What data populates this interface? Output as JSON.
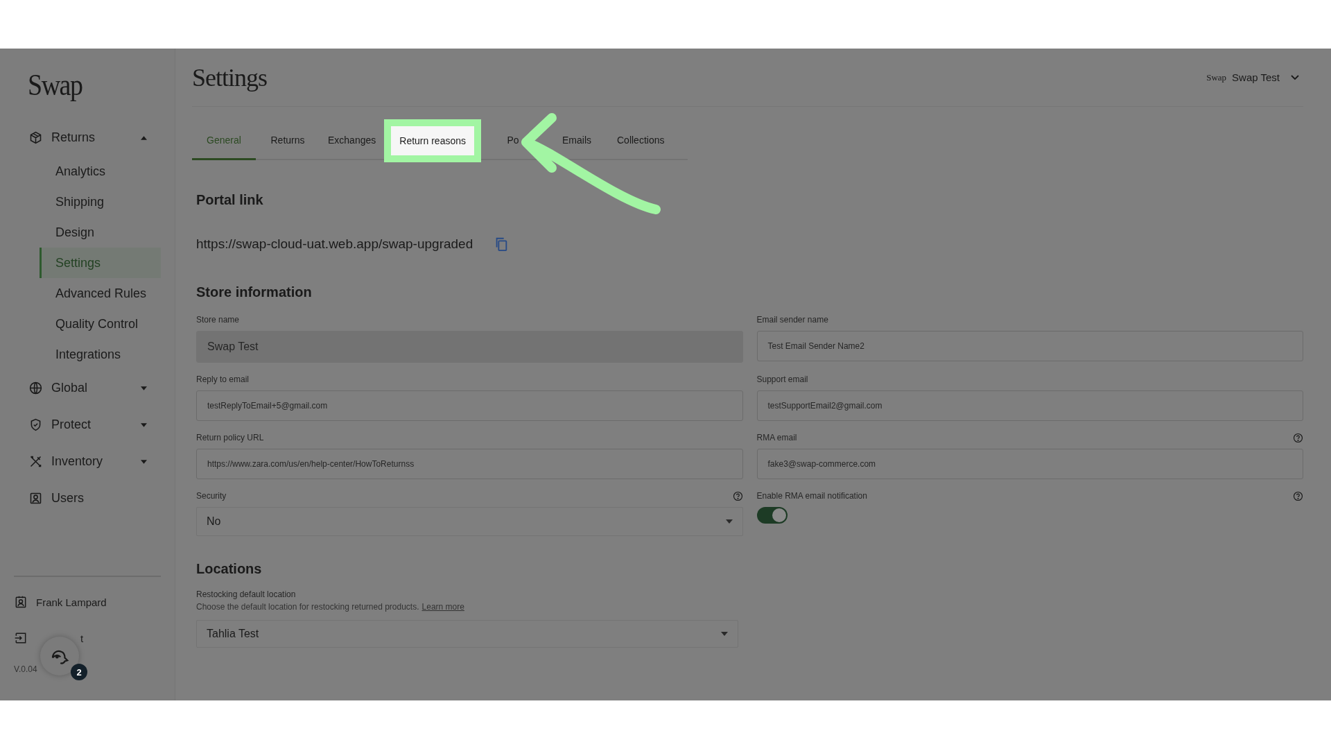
{
  "brand": {
    "logo": "Swap"
  },
  "sidebar": {
    "items": [
      {
        "label": "Returns",
        "kind": "group",
        "expanded": true,
        "children": [
          {
            "label": "Analytics",
            "selected": false
          },
          {
            "label": "Shipping",
            "selected": false
          },
          {
            "label": "Design",
            "selected": false
          },
          {
            "label": "Settings",
            "selected": true
          },
          {
            "label": "Advanced Rules",
            "selected": false
          },
          {
            "label": "Quality Control",
            "selected": false
          },
          {
            "label": "Integrations",
            "selected": false
          }
        ]
      },
      {
        "label": "Global",
        "kind": "group",
        "expanded": false
      },
      {
        "label": "Protect",
        "kind": "group",
        "expanded": false
      },
      {
        "label": "Inventory",
        "kind": "group",
        "expanded": false
      },
      {
        "label": "Users",
        "kind": "link"
      }
    ],
    "footer": {
      "user": "Frank Lampard",
      "logout": "t",
      "version": "V.0.04",
      "chat_badge": "2"
    }
  },
  "header": {
    "title": "Settings",
    "account_logo": "Swap",
    "account_name": "Swap Test"
  },
  "tabs": [
    {
      "label": "General",
      "selected": true,
      "highlighted": false
    },
    {
      "label": "Returns",
      "selected": false,
      "highlighted": false
    },
    {
      "label": "Exchanges",
      "selected": false,
      "highlighted": false
    },
    {
      "label": "Return reasons",
      "selected": false,
      "highlighted": true
    },
    {
      "label": "Po",
      "selected": false,
      "highlighted": false
    },
    {
      "label": "Emails",
      "selected": false,
      "highlighted": false
    },
    {
      "label": "Collections",
      "selected": false,
      "highlighted": false
    }
  ],
  "portal": {
    "heading": "Portal link",
    "url": "https://swap-cloud-uat.web.app/swap-upgraded"
  },
  "store": {
    "heading": "Store information",
    "fields": [
      {
        "label": "Store name",
        "kind": "input",
        "value": "Swap Test",
        "disabled": true,
        "help": false
      },
      {
        "label": "Email sender name",
        "kind": "input",
        "value": "Test Email Sender Name2",
        "disabled": false,
        "help": false
      },
      {
        "label": "Reply to email",
        "kind": "input",
        "value": "testReplyToEmail+5@gmail.com",
        "disabled": false,
        "help": false
      },
      {
        "label": "Support email",
        "kind": "input",
        "value": "testSupportEmail2@gmail.com",
        "disabled": false,
        "help": false
      },
      {
        "label": "Return policy URL",
        "kind": "input",
        "value": "https://www.zara.com/us/en/help-center/HowToReturnss",
        "disabled": false,
        "help": false
      },
      {
        "label": "RMA email",
        "kind": "input",
        "value": "fake3@swap-commerce.com",
        "disabled": false,
        "help": true
      },
      {
        "label": "Security",
        "kind": "select",
        "value": "No",
        "help": true
      },
      {
        "label": "Enable RMA email notification",
        "kind": "toggle",
        "on": true,
        "help": true
      }
    ]
  },
  "locations": {
    "heading": "Locations",
    "label": "Restocking default location",
    "description": "Choose the default location for restocking returned products.",
    "link": "Learn more",
    "value": "Tahlia Test"
  }
}
